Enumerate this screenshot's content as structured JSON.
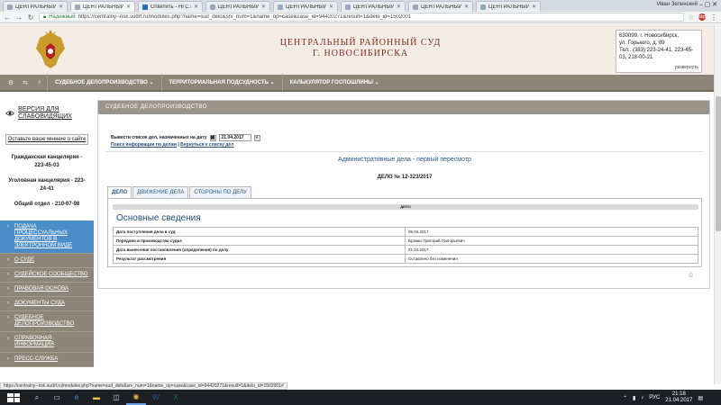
{
  "browser": {
    "tabs": [
      {
        "title": "ЦЕНТРАЛЬНЫЙ РАЙО",
        "active": false
      },
      {
        "title": "ЦЕНТРАЛЬНЫЙ РАЙО",
        "active": true
      },
      {
        "title": "Ответить - НГС.Недви",
        "active": false
      },
      {
        "title": "ЦЕНТРАЛЬНЫЙ РАЙО",
        "active": false
      },
      {
        "title": "ЦЕНТРАЛЬНЫЙ РАЙО",
        "active": false
      },
      {
        "title": "ЦЕНТРАЛЬНЫЙ РАЙО",
        "active": false
      },
      {
        "title": "ЦЕНТРАЛЬНЫЙ РАЙО",
        "active": false
      },
      {
        "title": "ЦЕНТРАЛЬНЫЙ РАЙО",
        "active": false
      }
    ],
    "user": "Иван Зеленский",
    "security_label": "Надежный",
    "url": "https://centralny--nsk.sudrf.ru/modules.php?name=sud_delo&srv_num=1&name_op=case&case_id=94420271&result=1&delo_id=1502001",
    "status_url": "https://centralny--nsk.sudrf.ru/modules.php?name=sud_delo&srv_num=1&name_op=case&case_id=94420271&result=1&delo_id=1502001#"
  },
  "header": {
    "court_line1": "ЦЕНТРАЛЬНЫЙ РАЙОННЫЙ СУД",
    "court_line2": "Г. НОВОСИБИРСКА",
    "contact_line1": "630099, г. Новосибирск,",
    "contact_line2": "ул. Горького, д. 89",
    "contact_line3": "Тел.: (383) 223-24-41, 223-45-",
    "contact_line4": "03, 218-00-21",
    "expand": "развернуть"
  },
  "topnav": {
    "items": [
      "СУДЕБНОЕ ДЕЛОПРОИЗВОДСТВО",
      "ТЕРРИТОРИАЛЬНАЯ ПОДСУДНОСТЬ",
      "КАЛЬКУЛЯТОР ГОСПОШЛИНЫ"
    ]
  },
  "sidebar": {
    "vision_label": "ВЕРСИЯ ДЛЯ СЛАБОВИДЯЩИХ",
    "opinion": "Оставьте ваше мнение о сайте",
    "phones": [
      "Гражданская канцелярия - 223-45-03",
      "Уголовная канцелярия - 223-24-41",
      "Общий отдел - 210-07-98"
    ],
    "menu": [
      "ПОДАЧА ПРОЦЕССУАЛЬНЫХ ДОКУМЕНТОВ В ЭЛЕКТРОННОМ ВИДЕ",
      "О СУДЕ",
      "СУДЕЙСКОЕ СООБЩЕСТВО",
      "ПРАВОВАЯ ОСНОВА",
      "ДОКУМЕНТЫ СУДА",
      "СУДЕБНОЕ ДЕЛОПРОИЗВОДСТВО",
      "СПРАВОЧНАЯ ИНФОРМАЦИЯ",
      "ПРЕСС-СЛУЖБА"
    ]
  },
  "main": {
    "section_header": "СУДЕБНОЕ ДЕЛОПРОИЗВОДСТВО",
    "date_label": "Вывести список дел, назначенных на дату",
    "date_value": "21.04.2017",
    "link_search": "Поиск информации по делам",
    "link_back": "Вернуться к списку дел",
    "category": "Административные дела - первый пересмотр",
    "case_number": "ДЕЛО № 12-323/2017",
    "tabs": [
      "ДЕЛО",
      "ДВИЖЕНИЕ ДЕЛА",
      "СТОРОНЫ ПО ДЕЛУ"
    ],
    "panel_header": "ДЕЛО",
    "section_title": "Основные сведения",
    "rows": [
      {
        "label": "Дата поступления дела в суд",
        "value": "06.04.2017"
      },
      {
        "label": "Передано в производство судье",
        "value": "Бражко Григорий Григорьевич"
      },
      {
        "label": "Дата вынесения постановления (определения) по делу",
        "value": "21.04.2017"
      },
      {
        "label": "Результат рассмотрения",
        "value": "Оставлено без изменения"
      }
    ]
  },
  "taskbar": {
    "lang": "РУС",
    "time": "21:18",
    "date": "21.04.2017"
  }
}
